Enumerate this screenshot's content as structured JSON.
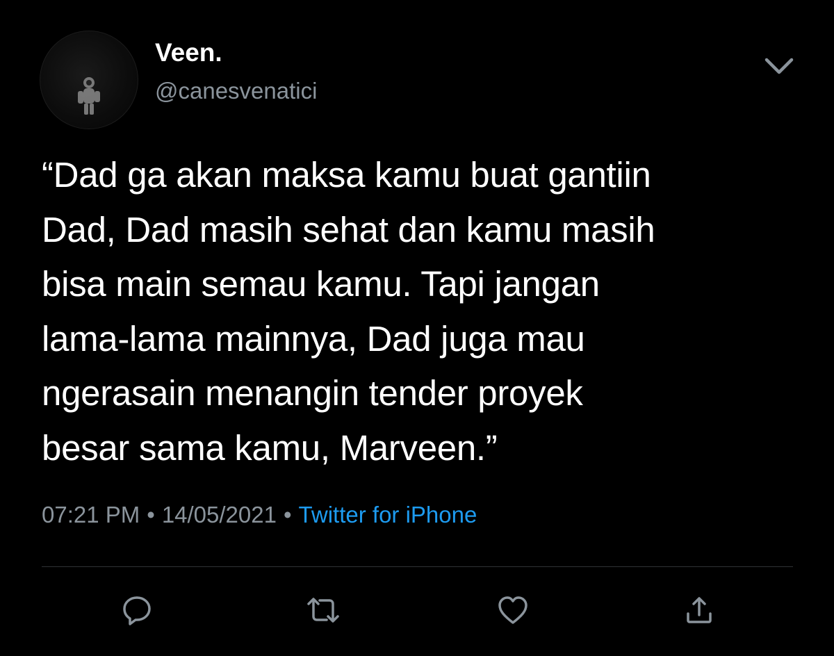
{
  "user": {
    "display_name": "Veen.",
    "handle": "@canesvenatici"
  },
  "tweet": {
    "lines": [
      "“Dad ga akan maksa kamu buat gantiin",
      "Dad, Dad masih sehat dan kamu masih",
      "bisa main semau kamu. Tapi jangan",
      "lama-lama mainnya, Dad juga mau",
      "ngerasain menangin tender proyek",
      "besar sama kamu, Marveen.”"
    ]
  },
  "meta": {
    "time": "07:21 PM",
    "separator": "•",
    "date": "14/05/2021",
    "source": "Twitter for iPhone"
  },
  "icons": {
    "menu": "chevron-down-icon",
    "reply": "reply-icon",
    "retweet": "retweet-icon",
    "like": "heart-icon",
    "share": "share-icon"
  },
  "colors": {
    "background": "#000000",
    "text_primary": "#ffffff",
    "text_secondary": "#8b949c",
    "link": "#1d9bf0",
    "divider": "#2f3336"
  }
}
